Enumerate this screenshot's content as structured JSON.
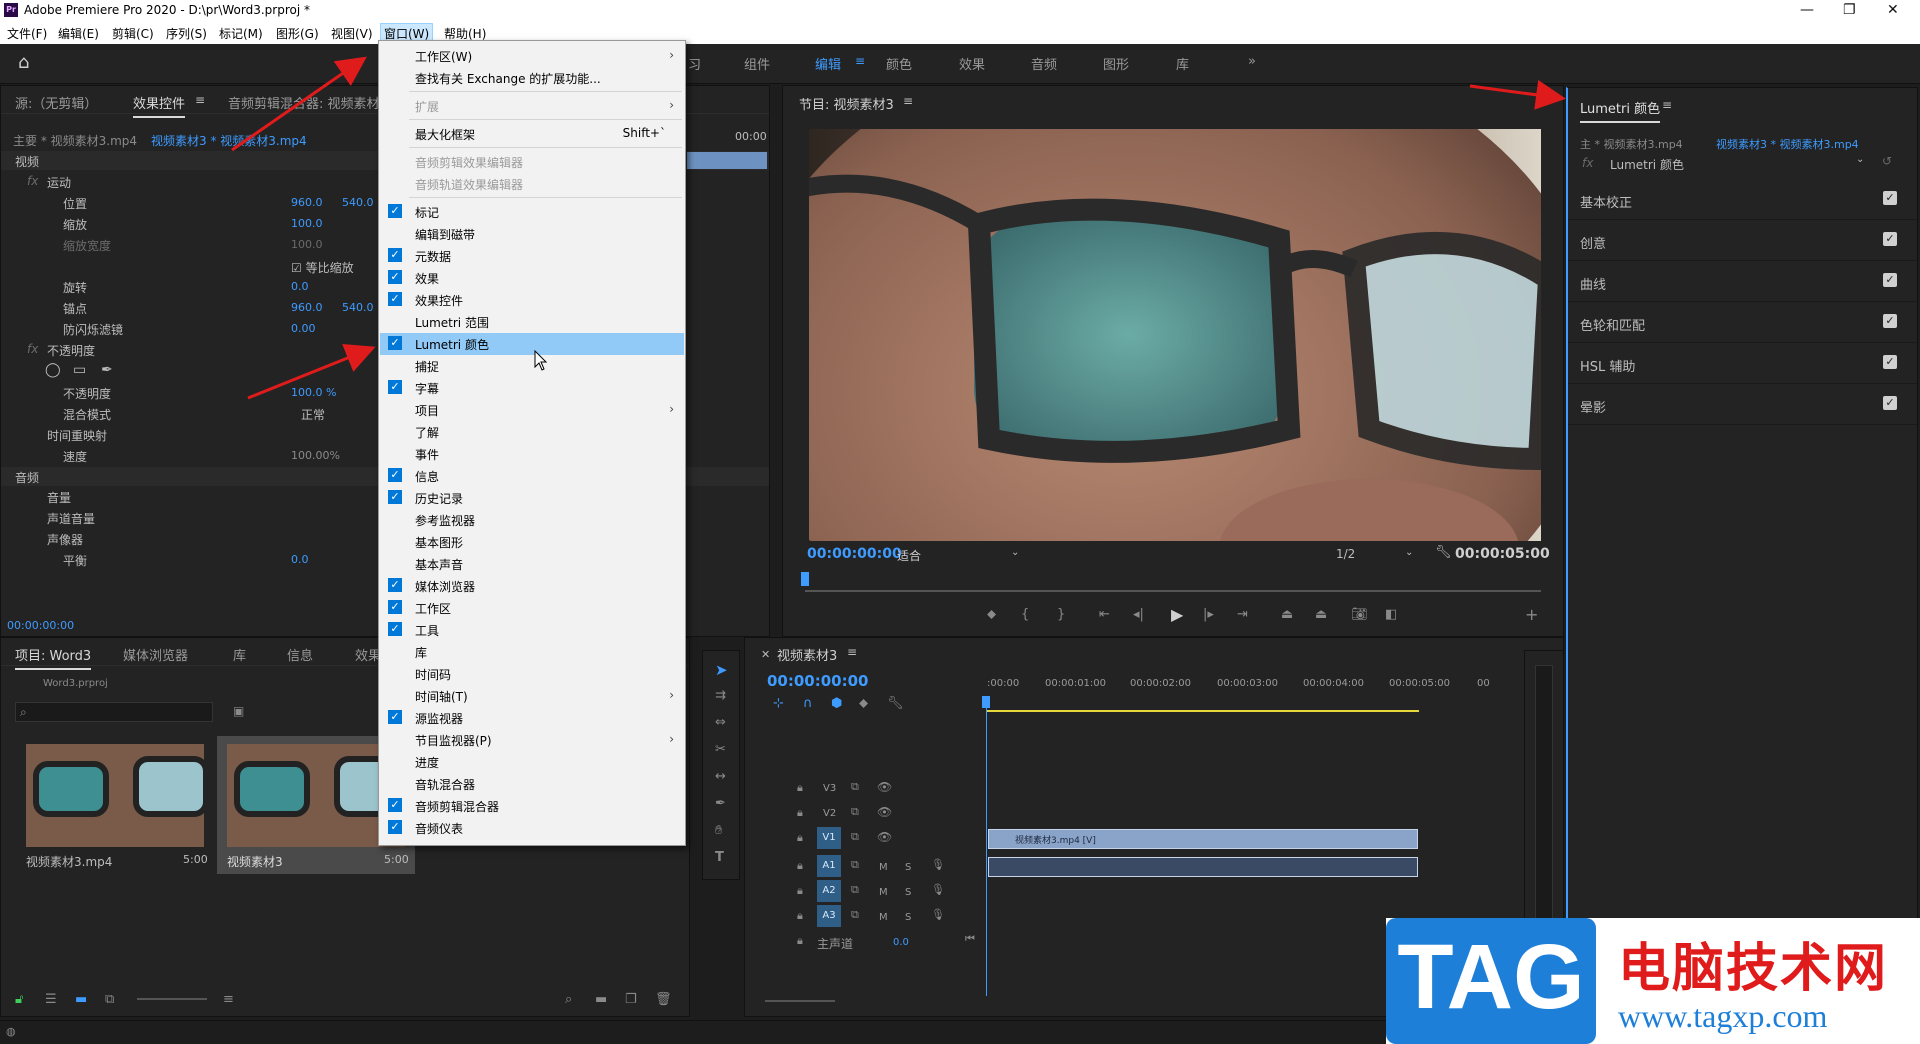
{
  "app": {
    "title": "Adobe Premiere Pro 2020 - D:\\pr\\Word3.prproj *"
  },
  "menubar": [
    "文件(F)",
    "编辑(E)",
    "剪辑(C)",
    "序列(S)",
    "标记(M)",
    "图形(G)",
    "视图(V)",
    "窗口(W)",
    "帮助(H)"
  ],
  "workspaces": [
    "组件",
    "编辑",
    "颜色",
    "效果",
    "音频",
    "图形",
    "库"
  ],
  "workspace_active": "编辑",
  "workspace_partial": "习",
  "source_panel": {
    "tabs": [
      "源:（无剪辑）",
      "效果控件",
      "音频剪辑混合器: 视频素材"
    ],
    "clip_master": "主要 * 视频素材3.mp4",
    "clip_seq": "视频素材3 * 视频素材3.mp4",
    "section_video": "视频",
    "motion": "运动",
    "props": [
      {
        "name": "位置",
        "v1": "960.0",
        "v2": "540.0"
      },
      {
        "name": "缩放",
        "v1": "100.0",
        "v2": ""
      },
      {
        "name": "缩放宽度",
        "v1": "100.0",
        "v2": ""
      },
      {
        "name": "旋转",
        "v1": "0.0",
        "v2": ""
      },
      {
        "name": "锚点",
        "v1": "960.0",
        "v2": "540.0"
      },
      {
        "name": "防闪烁滤镜",
        "v1": "0.00",
        "v2": ""
      }
    ],
    "uniform_scale": "等比缩放",
    "opacity": "不透明度",
    "opacity_prop": "不透明度",
    "opacity_value": "100.0 %",
    "blend_mode": "混合模式",
    "blend_value": "正常",
    "time_remap": "时间重映射",
    "speed": "速度",
    "speed_value": "100.00%",
    "section_audio": "音频",
    "volume": "音量",
    "channel_volume": "声道音量",
    "panner": "声像器",
    "balance": "平衡",
    "balance_value": "0.0",
    "timecode": "00:00:00:00",
    "mini_time": "00:00"
  },
  "project_panel": {
    "tabs": [
      "项目: Word3",
      "媒体浏览器",
      "库",
      "信息",
      "效果"
    ],
    "file": "Word3.prproj",
    "items": [
      {
        "name": "视频素材3.mp4",
        "duration": "5:00"
      },
      {
        "name": "视频素材3",
        "duration": "5:00"
      }
    ]
  },
  "window_menu": {
    "items": [
      {
        "label": "工作区(W)",
        "check": false,
        "sub": true,
        "dis": false
      },
      {
        "label": "查找有关 Exchange 的扩展功能...",
        "check": false,
        "sub": false,
        "dis": false
      },
      {
        "sep": true
      },
      {
        "label": "扩展",
        "check": false,
        "sub": true,
        "dis": true
      },
      {
        "sep": true
      },
      {
        "label": "最大化框架",
        "check": false,
        "sub": false,
        "dis": false,
        "shortcut": "Shift+`"
      },
      {
        "sep": true
      },
      {
        "label": "音频剪辑效果编辑器",
        "check": false,
        "sub": false,
        "dis": true
      },
      {
        "label": "音频轨道效果编辑器",
        "check": false,
        "sub": false,
        "dis": true
      },
      {
        "sep": true
      },
      {
        "label": "标记",
        "check": true
      },
      {
        "label": "编辑到磁带",
        "check": false
      },
      {
        "label": "元数据",
        "check": true
      },
      {
        "label": "效果",
        "check": true
      },
      {
        "label": "效果控件",
        "check": true
      },
      {
        "label": "Lumetri 范围",
        "check": false
      },
      {
        "label": "Lumetri 颜色",
        "check": true,
        "hl": true
      },
      {
        "label": "捕捉",
        "check": false
      },
      {
        "label": "字幕",
        "check": true
      },
      {
        "label": "项目",
        "check": false,
        "sub": true
      },
      {
        "label": "了解",
        "check": false
      },
      {
        "label": "事件",
        "check": false
      },
      {
        "label": "信息",
        "check": true
      },
      {
        "label": "历史记录",
        "check": true
      },
      {
        "label": "参考监视器",
        "check": false
      },
      {
        "label": "基本图形",
        "check": false
      },
      {
        "label": "基本声音",
        "check": false
      },
      {
        "label": "媒体浏览器",
        "check": true
      },
      {
        "label": "工作区",
        "check": true
      },
      {
        "label": "工具",
        "check": true
      },
      {
        "label": "库",
        "check": false
      },
      {
        "label": "时间码",
        "check": false
      },
      {
        "label": "时间轴(T)",
        "check": false,
        "sub": true
      },
      {
        "label": "源监视器",
        "check": true
      },
      {
        "label": "节目监视器(P)",
        "check": false,
        "sub": true
      },
      {
        "label": "进度",
        "check": false
      },
      {
        "label": "音轨混合器",
        "check": false
      },
      {
        "label": "音频剪辑混合器",
        "check": true
      },
      {
        "label": "音频仪表",
        "check": true
      }
    ]
  },
  "program_monitor": {
    "title": "节目: 视频素材3",
    "timecode": "00:00:00:00",
    "fit": "适合",
    "resolution": "1/2",
    "duration": "00:00:05:00"
  },
  "timeline": {
    "title": "视频素材3",
    "timecode": "00:00:00:00",
    "ruler": [
      ":00:00",
      "00:00:01:00",
      "00:00:02:00",
      "00:00:03:00",
      "00:00:04:00",
      "00:00:05:00",
      "00"
    ],
    "video_tracks": [
      "V3",
      "V2",
      "V1"
    ],
    "audio_tracks": [
      "A1",
      "A2",
      "A3"
    ],
    "master": "主声道",
    "master_value": "0.0",
    "clip_label": "视频素材3.mp4 [V]",
    "mute": "M",
    "solo": "S"
  },
  "lumetri": {
    "title": "Lumetri 颜色",
    "master": "主 * 视频素材3.mp4",
    "seq": "视频素材3 * 视频素材3.mp4",
    "fx": "Lumetri 颜色",
    "sections": [
      "基本校正",
      "创意",
      "曲线",
      "色轮和匹配",
      "HSL 辅助",
      "晕影"
    ]
  },
  "watermark": {
    "tag": "TAG",
    "cn": "电脑技术网",
    "url": "www.tagxp.com"
  },
  "colors": {
    "accent": "#3e9bff",
    "menu_highlight": "#91c9f7",
    "arrow": "#e01b1b",
    "timecode": "#3e9bff"
  }
}
